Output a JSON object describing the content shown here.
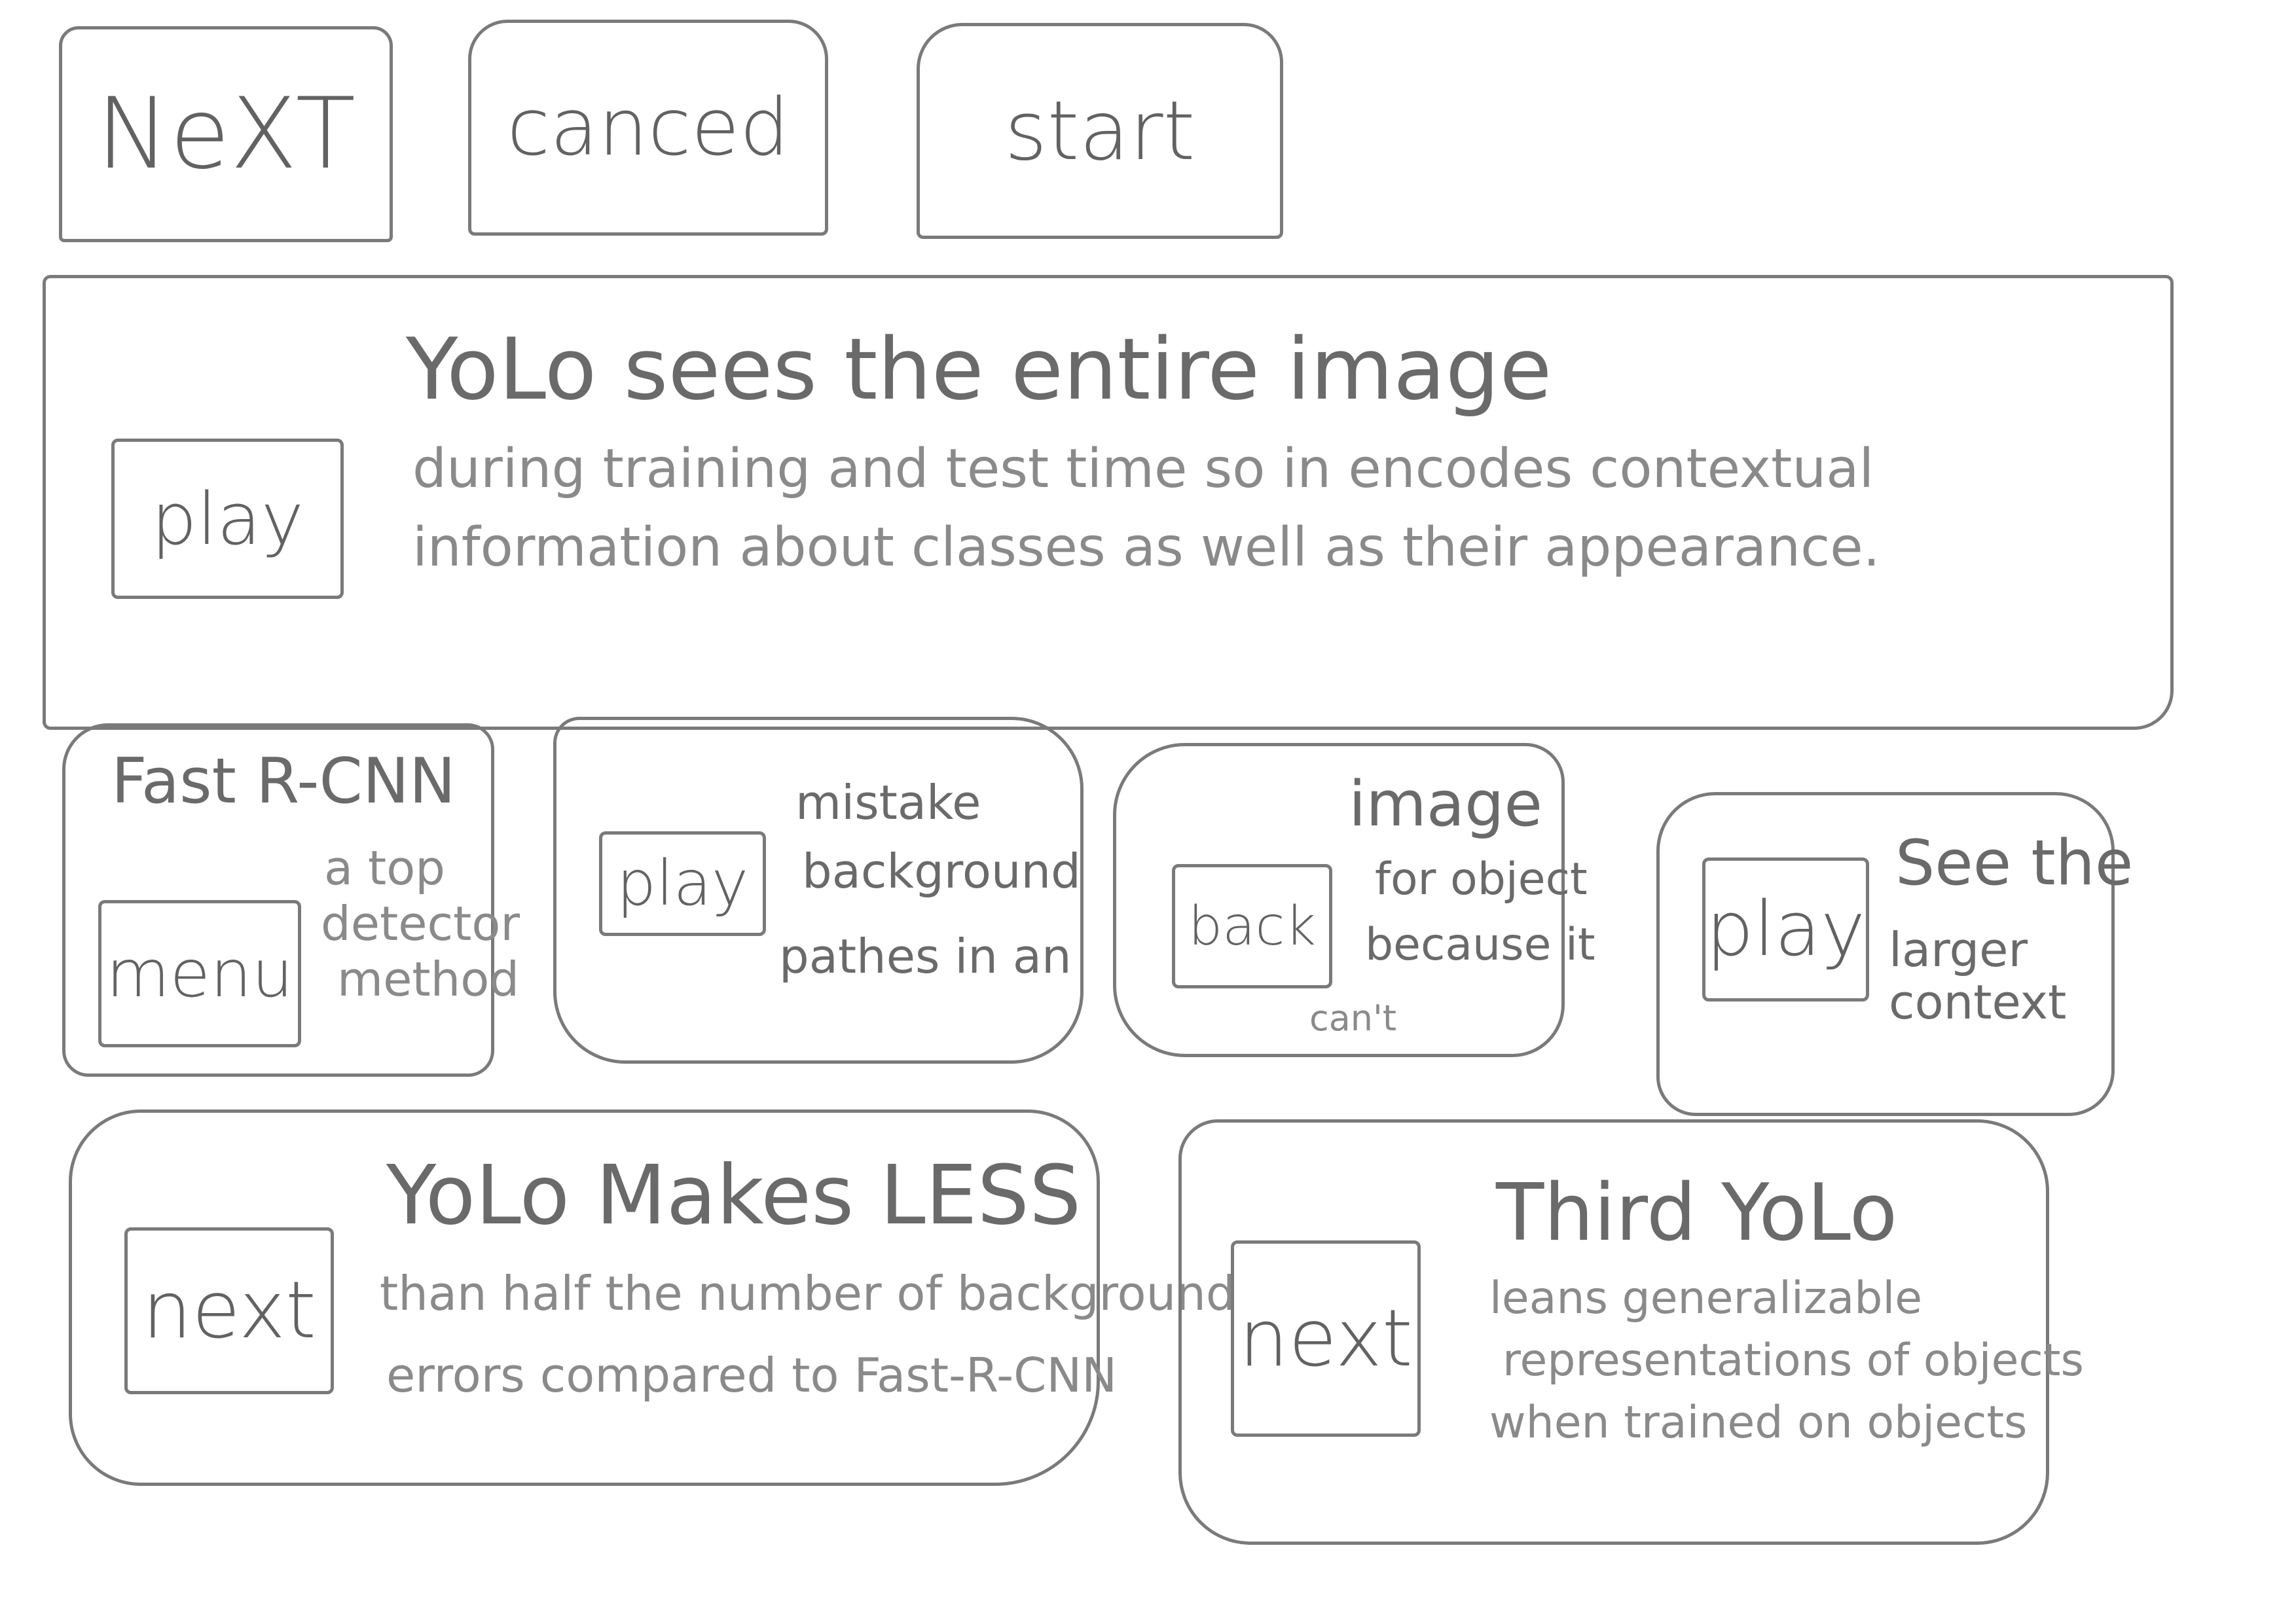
{
  "top_buttons": {
    "next": "NeXT",
    "cancel": "canced",
    "start": "start"
  },
  "hero": {
    "button": "play",
    "title": "YoLo sees the entire image",
    "line1": "during training and test time so in encodes contextual",
    "line2": "information about classes as well as their appearance."
  },
  "cards": {
    "fast": {
      "title": "Fast R-CNN",
      "button": "menu",
      "line1": "a top",
      "line2": "detector",
      "line3": "method"
    },
    "mistake": {
      "button": "play",
      "line1": "mistake",
      "line2": "background",
      "line3": "pathes in an"
    },
    "image": {
      "button": "back",
      "line1": "image",
      "line2": "for object",
      "line3": "because it",
      "line4": "can't"
    },
    "see": {
      "button": "play",
      "line1": "See the",
      "line2": "larger",
      "line3": "context"
    }
  },
  "less": {
    "button": "next",
    "title": "YoLo Makes LESS",
    "line1": "than half the number of background",
    "line2": "errors compared to Fast-R-CNN"
  },
  "third": {
    "button": "next",
    "title": "Third YoLo",
    "line1": "leans generalizable",
    "line2": "representations of objects",
    "line3": "when trained on objects"
  }
}
